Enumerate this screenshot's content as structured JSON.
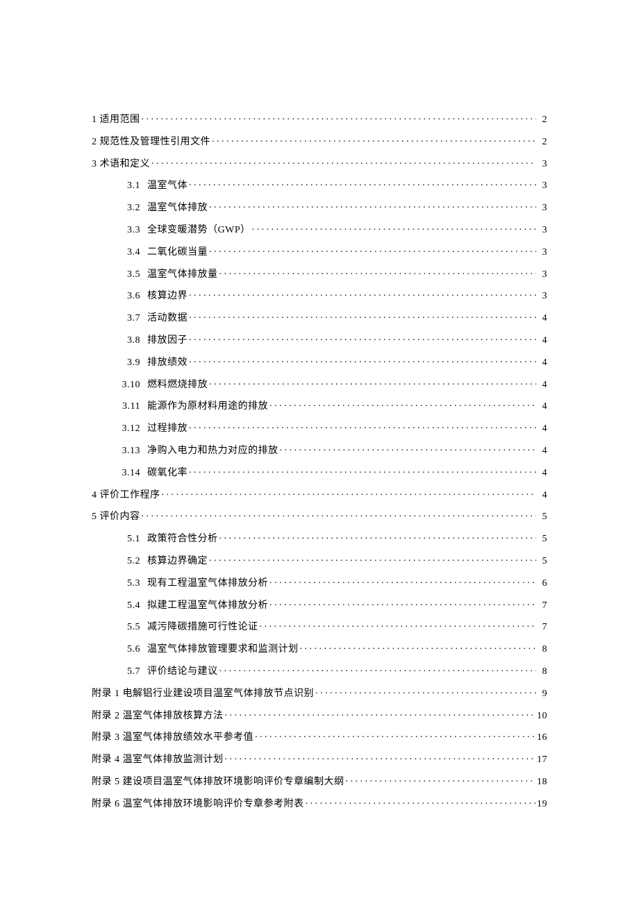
{
  "toc": [
    {
      "level": 1,
      "num": "1",
      "title": "适用范围",
      "page": "2"
    },
    {
      "level": 1,
      "num": "2",
      "title": "规范性及管理性引用文件",
      "page": "2"
    },
    {
      "level": 1,
      "num": "3",
      "title": "术语和定义",
      "page": "3"
    },
    {
      "level": 2,
      "num": "3.1",
      "title": "温室气体",
      "page": "3"
    },
    {
      "level": 2,
      "num": "3.2",
      "title": "温室气体排放",
      "page": "3"
    },
    {
      "level": 2,
      "num": "3.3",
      "title": "全球变暖潜势（GWP）",
      "page": "3"
    },
    {
      "level": 2,
      "num": "3.4",
      "title": "二氧化碳当量",
      "page": "3"
    },
    {
      "level": 2,
      "num": "3.5",
      "title": "温室气体排放量",
      "page": "3"
    },
    {
      "level": 2,
      "num": "3.6",
      "title": "核算边界",
      "page": "3"
    },
    {
      "level": 2,
      "num": "3.7",
      "title": "活动数据",
      "page": "4"
    },
    {
      "level": 2,
      "num": "3.8",
      "title": "排放因子",
      "page": "4"
    },
    {
      "level": 2,
      "num": "3.9",
      "title": "排放绩效",
      "page": "4"
    },
    {
      "level": 2,
      "num": "3.10",
      "title": "燃料燃烧排放",
      "page": "4"
    },
    {
      "level": 2,
      "num": "3.11",
      "title": "能源作为原材料用途的排放",
      "page": "4"
    },
    {
      "level": 2,
      "num": "3.12",
      "title": "过程排放",
      "page": "4"
    },
    {
      "level": 2,
      "num": "3.13",
      "title": "净购入电力和热力对应的排放",
      "page": "4"
    },
    {
      "level": 2,
      "num": "3.14",
      "title": "碳氧化率",
      "page": "4"
    },
    {
      "level": 1,
      "num": "4",
      "title": "评价工作程序",
      "page": "4"
    },
    {
      "level": 1,
      "num": "5",
      "title": "评价内容",
      "page": "5"
    },
    {
      "level": 2,
      "num": "5.1",
      "title": "政策符合性分析",
      "page": "5"
    },
    {
      "level": 2,
      "num": "5.2",
      "title": "核算边界确定",
      "page": "5"
    },
    {
      "level": 2,
      "num": "5.3",
      "title": "现有工程温室气体排放分析",
      "page": "6"
    },
    {
      "level": 2,
      "num": "5.4",
      "title": "拟建工程温室气体排放分析",
      "page": "7"
    },
    {
      "level": 2,
      "num": "5.5",
      "title": "减污降碳措施可行性论证",
      "page": "7"
    },
    {
      "level": 2,
      "num": "5.6",
      "title": "温室气体排放管理要求和监测计划",
      "page": "8"
    },
    {
      "level": 2,
      "num": "5.7",
      "title": "评价结论与建议",
      "page": "8"
    },
    {
      "level": 1,
      "num": "",
      "title": "附录 1 电解铝行业建设项目温室气体排放节点识别",
      "page": "9"
    },
    {
      "level": 1,
      "num": "",
      "title": "附录 2 温室气体排放核算方法",
      "page": "10"
    },
    {
      "level": 1,
      "num": "",
      "title": "附录 3 温室气体排放绩效水平参考值",
      "page": "16"
    },
    {
      "level": 1,
      "num": "",
      "title": "附录 4 温室气体排放监测计划",
      "page": "17"
    },
    {
      "level": 1,
      "num": "",
      "title": "附录 5 建设项目温室气体排放环境影响评价专章编制大纲",
      "page": "18"
    },
    {
      "level": 1,
      "num": "",
      "title": "附录 6 温室气体排放环境影响评价专章参考附表",
      "page": "19"
    }
  ]
}
